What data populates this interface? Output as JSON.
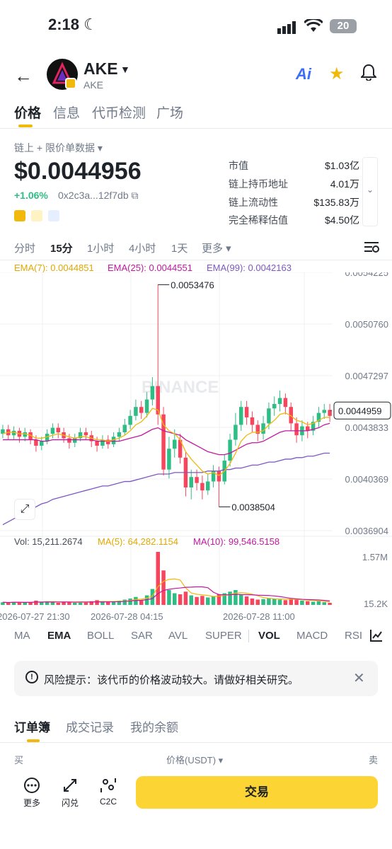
{
  "status_bar": {
    "time": "2:18",
    "moon": "☾",
    "battery": "20"
  },
  "header": {
    "token_name": "AKE",
    "token_sub": "AKE",
    "ai_label": "Ai"
  },
  "tabs": [
    {
      "label": "价格"
    },
    {
      "label": "信息"
    },
    {
      "label": "代币检测"
    },
    {
      "label": "广场"
    }
  ],
  "info": {
    "data_source": "链上 + 限价单数据 ▾",
    "price": "$0.0044956",
    "change": "+1.06%",
    "address": "0x2c3a...12f7db",
    "stats": [
      {
        "label": "市值",
        "value": "$1.03亿"
      },
      {
        "label": "链上持币地址",
        "value": "4.01万"
      },
      {
        "label": "链上流动性",
        "value": "$135.83万"
      },
      {
        "label": "完全稀释估值",
        "value": "$4.50亿"
      }
    ]
  },
  "intervals": [
    {
      "label": "分时"
    },
    {
      "label": "15分"
    },
    {
      "label": "1小时"
    },
    {
      "label": "4小时"
    },
    {
      "label": "1天"
    },
    {
      "label": "更多 ▾"
    }
  ],
  "ema": {
    "ema7": "EMA(7): 0.0044851",
    "ema25": "EMA(25): 0.0044551",
    "ema99": "EMA(99): 0.0042163"
  },
  "volume_legend": {
    "vol": "Vol: 15,211.2674",
    "ma5": "MA(5): 64,282.1154",
    "ma10": "MA(10): 99,546.5158"
  },
  "indicator_tabs": [
    {
      "label": "MA"
    },
    {
      "label": "EMA"
    },
    {
      "label": "BOLL"
    },
    {
      "label": "SAR"
    },
    {
      "label": "AVL"
    },
    {
      "label": "SUPER"
    },
    {
      "label": "VOL"
    },
    {
      "label": "MACD"
    },
    {
      "label": "RSI"
    }
  ],
  "risk": {
    "text": "风险提示：该代币的价格波动较大。请做好相关研究。",
    "icon": "!"
  },
  "sub_tabs": [
    {
      "label": "订单簿"
    },
    {
      "label": "成交记录"
    },
    {
      "label": "我的余额"
    }
  ],
  "orderbook": {
    "buy": "买",
    "price_col": "价格(USDT) ▾",
    "sell": "卖"
  },
  "bottom_bar": {
    "more": "更多",
    "swap": "闪兑",
    "c2c": "C2C",
    "trade": "交易"
  },
  "chart_data": {
    "type": "candlestick",
    "watermark": "BINANCE",
    "price_axis": [
      "0.0054225",
      "0.0050760",
      "0.0047297",
      "0.0043833",
      "0.0040369",
      "0.0036904"
    ],
    "ylim": [
      0.0036904,
      0.0054225
    ],
    "current_price": "0.0044959",
    "max_label": "0.0053476",
    "min_label": "0.0038504",
    "vol_axis": [
      "1.57M",
      "15.2K"
    ],
    "time_labels": [
      "2026-07-27 21:30",
      "2026-07-28 04:15",
      "2026-07-28 11:00"
    ],
    "colors": {
      "up": "#2ebd85",
      "down": "#f6465d",
      "ema7": "#f0b90b",
      "ema25": "#c2189f",
      "ema99": "#7e57c2"
    },
    "candles": [
      [
        0.00434,
        0.00437,
        0.0044,
        0.00431
      ],
      [
        0.00437,
        0.00433,
        0.0044,
        0.0043
      ],
      [
        0.00433,
        0.00436,
        0.00439,
        0.0043
      ],
      [
        0.00436,
        0.00432,
        0.00438,
        0.00428
      ],
      [
        0.00432,
        0.00435,
        0.00438,
        0.00429
      ],
      [
        0.00435,
        0.0043,
        0.00437,
        0.00427
      ],
      [
        0.0043,
        0.00426,
        0.00433,
        0.00422
      ],
      [
        0.00426,
        0.00429,
        0.00432,
        0.00423
      ],
      [
        0.00429,
        0.00434,
        0.00437,
        0.00427
      ],
      [
        0.00434,
        0.00438,
        0.00441,
        0.00431
      ],
      [
        0.00438,
        0.00435,
        0.00441,
        0.00431
      ],
      [
        0.00435,
        0.00431,
        0.00438,
        0.00428
      ],
      [
        0.00431,
        0.00428,
        0.00434,
        0.00424
      ],
      [
        0.00428,
        0.00431,
        0.00434,
        0.00425
      ],
      [
        0.00431,
        0.00435,
        0.00438,
        0.00429
      ],
      [
        0.00435,
        0.00433,
        0.00438,
        0.0043
      ],
      [
        0.00433,
        0.00429,
        0.00436,
        0.00425
      ],
      [
        0.00429,
        0.00426,
        0.00432,
        0.00422
      ],
      [
        0.00426,
        0.0043,
        0.00433,
        0.00424
      ],
      [
        0.0043,
        0.00427,
        0.00433,
        0.00424
      ],
      [
        0.00427,
        0.00432,
        0.00435,
        0.00425
      ],
      [
        0.00432,
        0.00435,
        0.00438,
        0.00429
      ],
      [
        0.00435,
        0.0044,
        0.00444,
        0.00433
      ],
      [
        0.0044,
        0.00446,
        0.0045,
        0.00437
      ],
      [
        0.00446,
        0.00452,
        0.00457,
        0.00443
      ],
      [
        0.00452,
        0.00448,
        0.00456,
        0.00444
      ],
      [
        0.00448,
        0.00457,
        0.00462,
        0.00445
      ],
      [
        0.00457,
        0.00466,
        0.00472,
        0.00453
      ],
      [
        0.00466,
        0.00447,
        0.00534,
        0.0044
      ],
      [
        0.00447,
        0.0041,
        0.00452,
        0.00406
      ],
      [
        0.0041,
        0.00424,
        0.00432,
        0.00404
      ],
      [
        0.00424,
        0.0043,
        0.00437,
        0.00418
      ],
      [
        0.0043,
        0.00418,
        0.00434,
        0.00414
      ],
      [
        0.00418,
        0.00398,
        0.00422,
        0.00392
      ],
      [
        0.00398,
        0.00405,
        0.0041,
        0.0039
      ],
      [
        0.00405,
        0.00401,
        0.0041,
        0.00396
      ],
      [
        0.00401,
        0.00396,
        0.00406,
        0.0039
      ],
      [
        0.00396,
        0.00402,
        0.00407,
        0.00393
      ],
      [
        0.00402,
        0.00409,
        0.00413,
        0.00398
      ],
      [
        0.00409,
        0.00402,
        0.00412,
        0.00385
      ],
      [
        0.00402,
        0.00416,
        0.0042,
        0.004
      ],
      [
        0.00416,
        0.0043,
        0.00434,
        0.00412
      ],
      [
        0.0043,
        0.0044,
        0.00448,
        0.00426
      ],
      [
        0.0044,
        0.00452,
        0.00456,
        0.00436
      ],
      [
        0.00452,
        0.00445,
        0.00456,
        0.0044
      ],
      [
        0.00445,
        0.0044,
        0.00449,
        0.00435
      ],
      [
        0.0044,
        0.00434,
        0.00443,
        0.00429
      ],
      [
        0.00434,
        0.00441,
        0.00446,
        0.0043
      ],
      [
        0.00441,
        0.00451,
        0.00455,
        0.00437
      ],
      [
        0.00451,
        0.00454,
        0.00459,
        0.00446
      ],
      [
        0.00454,
        0.00458,
        0.00463,
        0.00449
      ],
      [
        0.00458,
        0.00452,
        0.00461,
        0.00447
      ],
      [
        0.00452,
        0.00441,
        0.00455,
        0.00436
      ],
      [
        0.00441,
        0.00433,
        0.00445,
        0.00428
      ],
      [
        0.00433,
        0.00439,
        0.00443,
        0.00429
      ],
      [
        0.00439,
        0.00436,
        0.00442,
        0.00431
      ],
      [
        0.00436,
        0.00442,
        0.00446,
        0.00433
      ],
      [
        0.00442,
        0.00448,
        0.00452,
        0.00438
      ],
      [
        0.00448,
        0.0045,
        0.00454,
        0.00444
      ],
      [
        0.0045,
        0.00446,
        0.00454,
        0.00442
      ]
    ],
    "volumes": [
      0.05,
      0.04,
      0.06,
      0.05,
      0.04,
      0.05,
      0.08,
      0.06,
      0.07,
      0.05,
      0.04,
      0.06,
      0.05,
      0.04,
      0.06,
      0.05,
      0.07,
      0.09,
      0.06,
      0.05,
      0.06,
      0.08,
      0.1,
      0.12,
      0.15,
      0.09,
      0.18,
      0.3,
      1.0,
      0.65,
      0.28,
      0.22,
      0.2,
      0.25,
      0.18,
      0.15,
      0.17,
      0.14,
      0.16,
      0.2,
      0.22,
      0.25,
      0.28,
      0.2,
      0.16,
      0.12,
      0.1,
      0.11,
      0.13,
      0.12,
      0.1,
      0.09,
      0.11,
      0.1,
      0.08,
      0.07,
      0.06,
      0.07,
      0.05,
      0.04
    ],
    "ema7": [
      0.00434,
      0.00435,
      0.00435,
      0.00434,
      0.00434,
      0.00433,
      0.00431,
      0.00431,
      0.00432,
      0.00433,
      0.00434,
      0.00433,
      0.00432,
      0.00431,
      0.00432,
      0.00432,
      0.00431,
      0.0043,
      0.0043,
      0.00429,
      0.0043,
      0.00431,
      0.00433,
      0.00436,
      0.0044,
      0.00442,
      0.00446,
      0.00451,
      0.0045,
      0.0044,
      0.00436,
      0.00434,
      0.0043,
      0.00422,
      0.00417,
      0.00413,
      0.00409,
      0.00407,
      0.00408,
      0.00406,
      0.00409,
      0.00414,
      0.00421,
      0.00429,
      0.00433,
      0.00435,
      0.00435,
      0.00436,
      0.0044,
      0.00443,
      0.00447,
      0.00448,
      0.00446,
      0.00443,
      0.00442,
      0.0044,
      0.00441,
      0.00443,
      0.00445,
      0.00445
    ],
    "ema25": [
      0.0043,
      0.0043,
      0.0043,
      0.0043,
      0.0043,
      0.0043,
      0.0043,
      0.00429,
      0.00429,
      0.0043,
      0.0043,
      0.0043,
      0.0043,
      0.0043,
      0.0043,
      0.0043,
      0.0043,
      0.00429,
      0.00429,
      0.00429,
      0.00429,
      0.00429,
      0.0043,
      0.00431,
      0.00432,
      0.00433,
      0.00435,
      0.00437,
      0.00438,
      0.00436,
      0.00435,
      0.00434,
      0.00433,
      0.0043,
      0.00428,
      0.00426,
      0.00424,
      0.00422,
      0.00421,
      0.0042,
      0.0042,
      0.00421,
      0.00423,
      0.00425,
      0.00427,
      0.00428,
      0.00428,
      0.00429,
      0.00431,
      0.00433,
      0.00435,
      0.00436,
      0.00436,
      0.00436,
      0.00436,
      0.00436,
      0.00437,
      0.00438,
      0.0044,
      0.00441
    ],
    "ema99": [
      0.00373,
      0.00375,
      0.00377,
      0.00379,
      0.00381,
      0.00383,
      0.00385,
      0.00387,
      0.00388,
      0.0039,
      0.00391,
      0.00392,
      0.00393,
      0.00394,
      0.00395,
      0.00396,
      0.00397,
      0.00398,
      0.00399,
      0.00399,
      0.004,
      0.00401,
      0.00402,
      0.00402,
      0.00403,
      0.00404,
      0.00405,
      0.00406,
      0.00407,
      0.00407,
      0.00407,
      0.00408,
      0.00408,
      0.00408,
      0.00408,
      0.00408,
      0.00408,
      0.00409,
      0.00409,
      0.00409,
      0.0041,
      0.0041,
      0.00411,
      0.00411,
      0.00412,
      0.00413,
      0.00413,
      0.00414,
      0.00415,
      0.00415,
      0.00416,
      0.00417,
      0.00417,
      0.00418,
      0.00418,
      0.00419,
      0.00419,
      0.0042,
      0.00421,
      0.00421
    ]
  }
}
